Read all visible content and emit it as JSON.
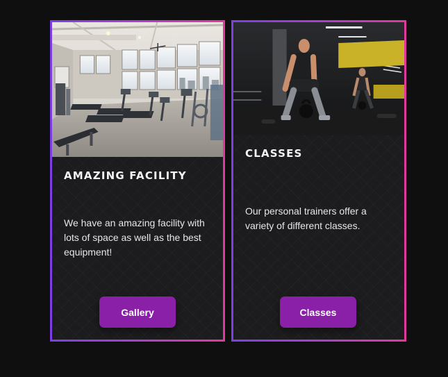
{
  "colors": {
    "page_background": "#0f0f10",
    "card_background": "#1c1c1e",
    "border_gradient_start": "#7b3fe4",
    "border_gradient_end": "#e0399b",
    "button_background": "#8a1fa8",
    "button_text": "#ffffff"
  },
  "cards": [
    {
      "image": "gym-facility-photo",
      "title": "Amazing Facility",
      "text": "We have an amazing facility with lots of space as well as the best equipment!",
      "button_label": "Gallery"
    },
    {
      "image": "kettlebell-training-photo",
      "title": "Classes",
      "text": "Our personal trainers offer a variety of different classes.",
      "button_label": "Classes"
    }
  ]
}
